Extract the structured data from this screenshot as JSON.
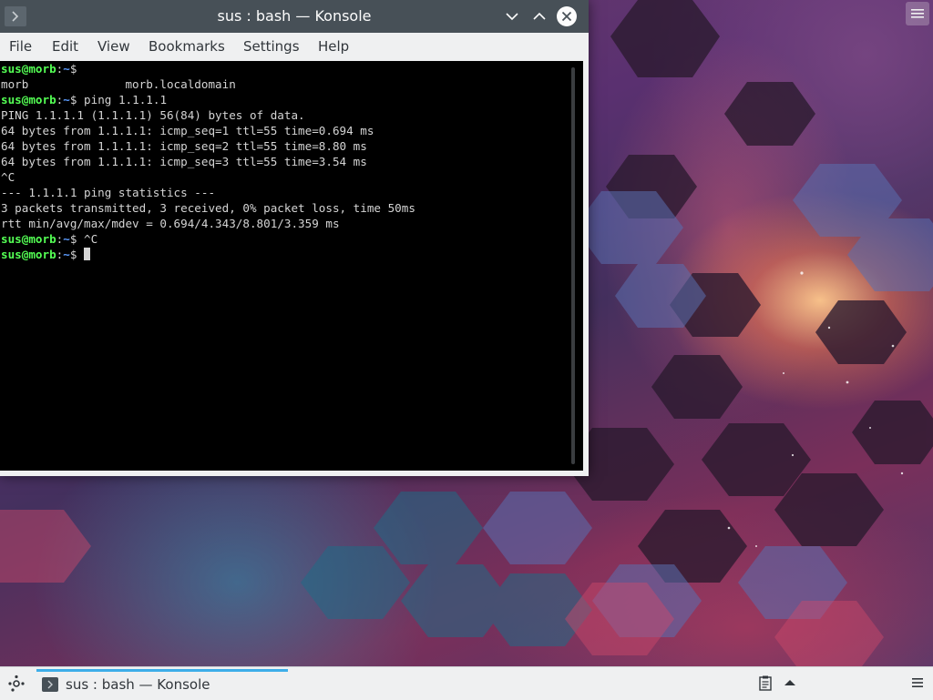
{
  "window": {
    "title": "sus : bash — Konsole",
    "menu": [
      "File",
      "Edit",
      "View",
      "Bookmarks",
      "Settings",
      "Help"
    ]
  },
  "terminal": {
    "lines": [
      {
        "type": "prompt",
        "user": "sus@morb",
        "colon": ":",
        "path": "~",
        "symbol": "$",
        "command": ""
      },
      {
        "type": "output",
        "text": "morb              morb.localdomain"
      },
      {
        "type": "prompt",
        "user": "sus@morb",
        "colon": ":",
        "path": "~",
        "symbol": "$",
        "command": " ping 1.1.1.1"
      },
      {
        "type": "output",
        "text": "PING 1.1.1.1 (1.1.1.1) 56(84) bytes of data."
      },
      {
        "type": "output",
        "text": "64 bytes from 1.1.1.1: icmp_seq=1 ttl=55 time=0.694 ms"
      },
      {
        "type": "output",
        "text": "64 bytes from 1.1.1.1: icmp_seq=2 ttl=55 time=8.80 ms"
      },
      {
        "type": "output",
        "text": "64 bytes from 1.1.1.1: icmp_seq=3 ttl=55 time=3.54 ms"
      },
      {
        "type": "output",
        "text": "^C"
      },
      {
        "type": "output",
        "text": "--- 1.1.1.1 ping statistics ---"
      },
      {
        "type": "output",
        "text": "3 packets transmitted, 3 received, 0% packet loss, time 50ms"
      },
      {
        "type": "output",
        "text": "rtt min/avg/max/mdev = 0.694/4.343/8.801/3.359 ms"
      },
      {
        "type": "prompt",
        "user": "sus@morb",
        "colon": ":",
        "path": "~",
        "symbol": "$",
        "command": " ^C"
      },
      {
        "type": "prompt",
        "user": "sus@morb",
        "colon": ":",
        "path": "~",
        "symbol": "$",
        "command": " ",
        "cursor": true
      }
    ]
  },
  "taskbar": {
    "task_label": "sus : bash — Konsole"
  },
  "icons": {
    "app": "konsole-icon",
    "minimize": "chevron-down-icon",
    "maximize": "chevron-up-icon",
    "close": "close-icon",
    "launcher": "application-launcher-icon",
    "clipboard": "clipboard-icon",
    "tray_expand": "triangle-up-icon",
    "panel_menu": "hamburger-menu-icon"
  },
  "colors": {
    "titlebar": "#475057",
    "prompt_user": "#54ff54",
    "prompt_path": "#5c9cff",
    "terminal_bg": "#000000",
    "task_active": "#3daee9"
  }
}
